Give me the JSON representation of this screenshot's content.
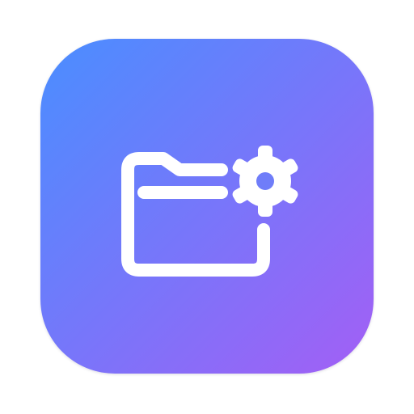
{
  "app_icon": {
    "icon": "folder-settings-icon",
    "gradient": {
      "start": "#4A8EFF",
      "end": "#A35FF5"
    },
    "glyph_color": "#FFFFFF",
    "parts": {
      "folder": "folder-icon",
      "gear": "gear-icon"
    }
  }
}
